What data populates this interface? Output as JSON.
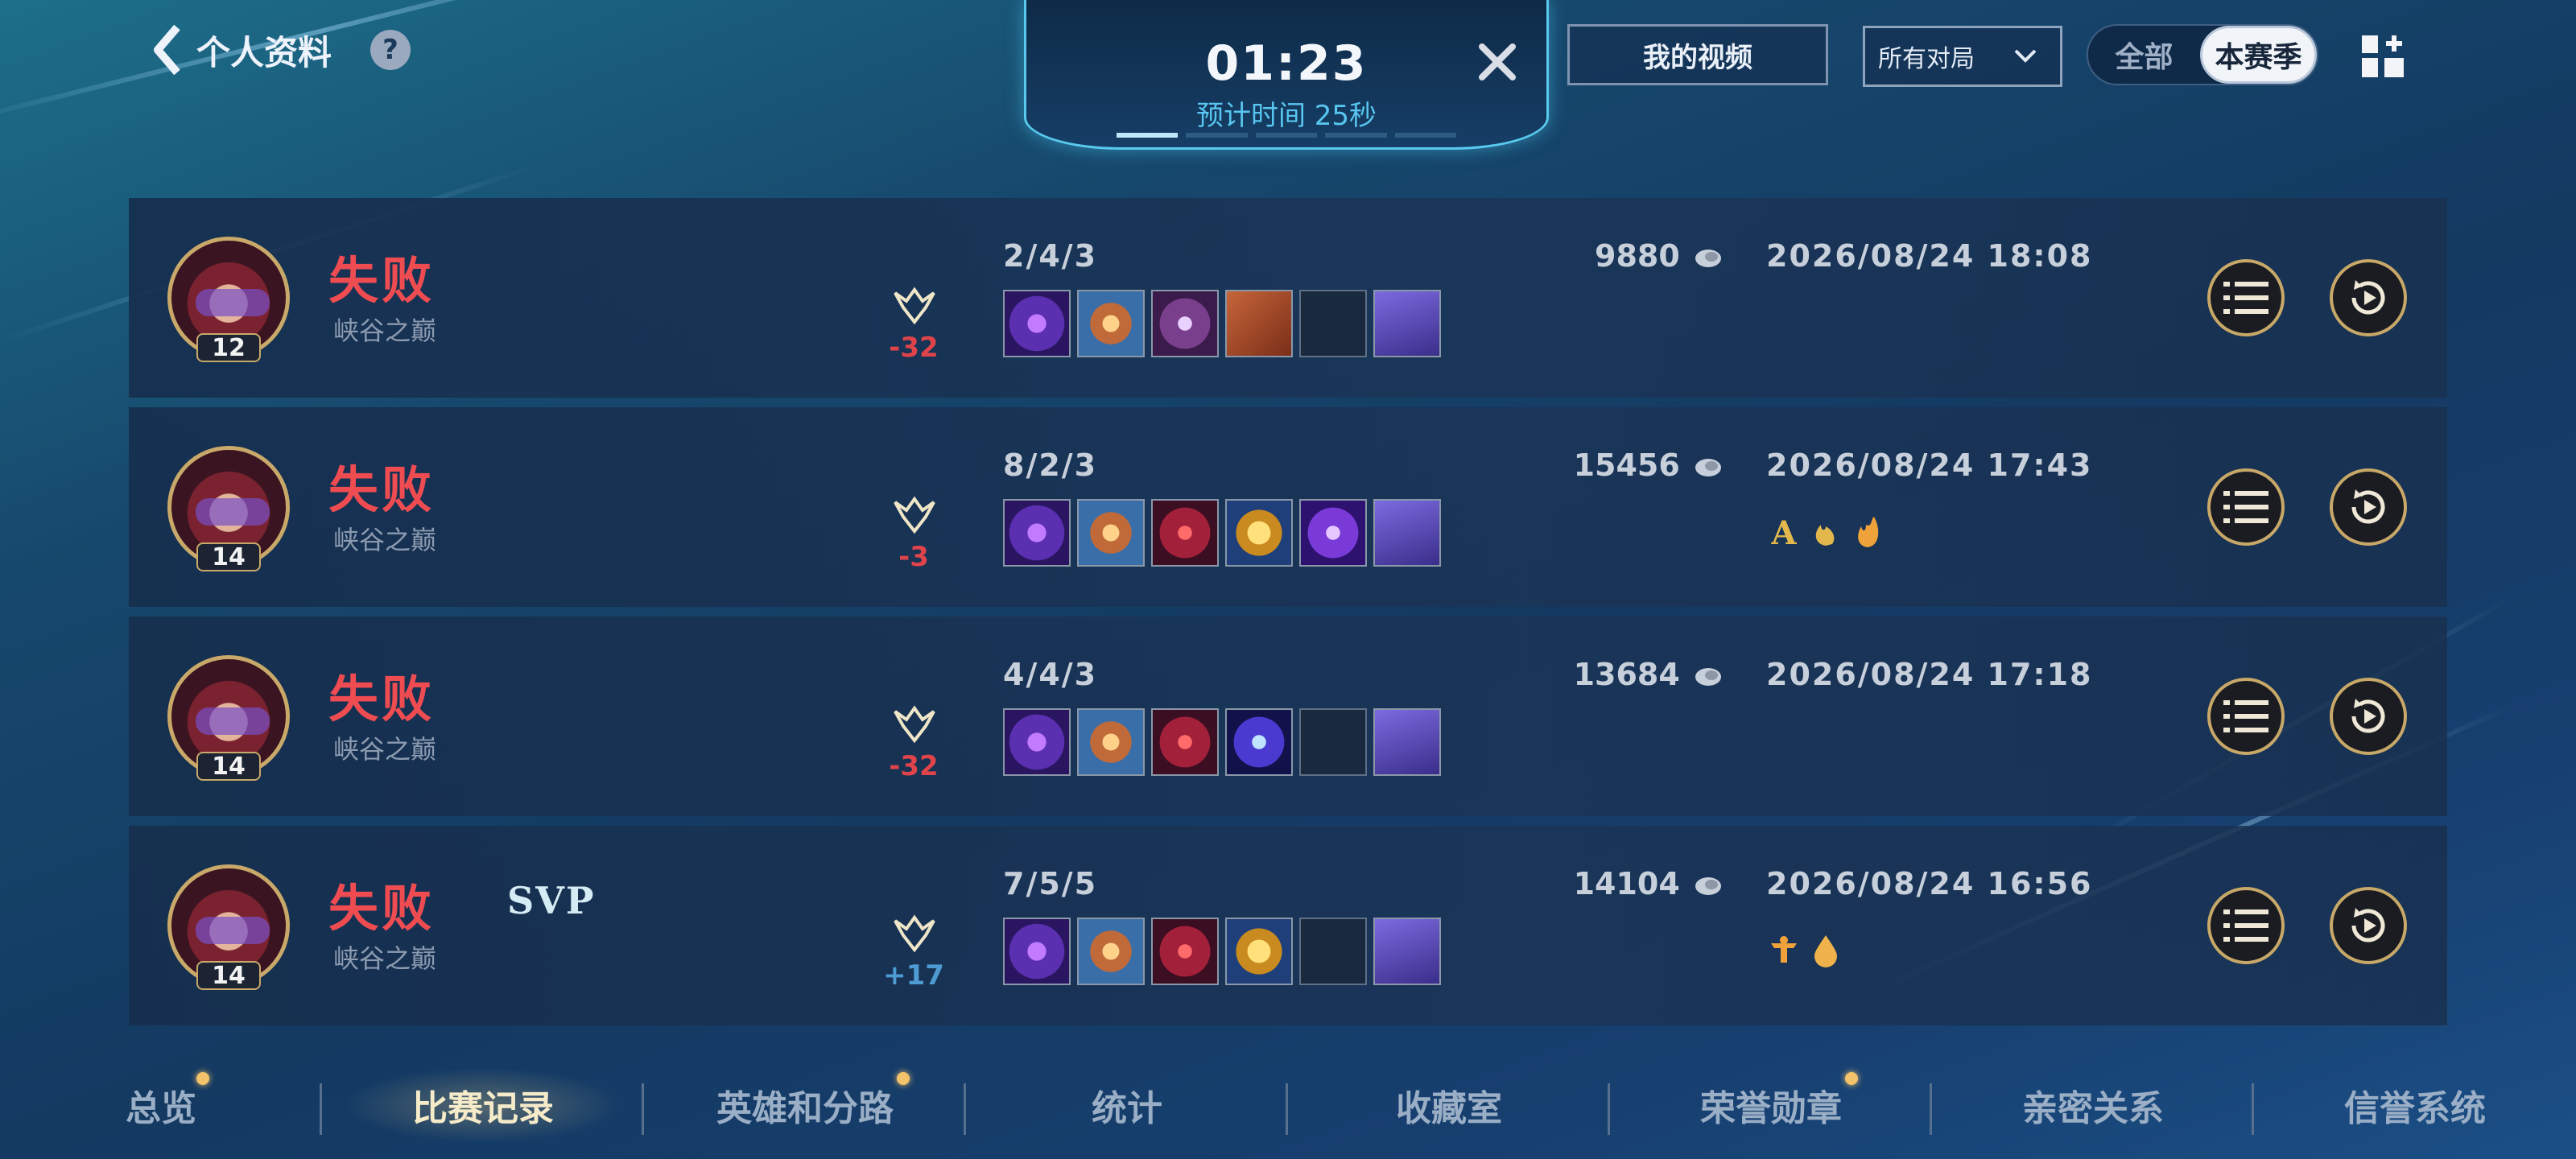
{
  "header": {
    "back_label": "个人资料",
    "help_label": "?",
    "timer": "01:23",
    "timer_sub": "预计时间 25秒",
    "my_video_label": "我的视频",
    "filter_selected": "所有对局",
    "segment": {
      "all_label": "全部",
      "season_label": "本赛季"
    }
  },
  "matches": [
    {
      "level": "12",
      "result": "失败",
      "mode": "峡谷之巅",
      "svp": "",
      "delta": "-32",
      "kda": "2/4/3",
      "gold": "9880",
      "date": "2026/08/24 18:08"
    },
    {
      "level": "14",
      "result": "失败",
      "mode": "峡谷之巅",
      "svp": "",
      "delta": "-3",
      "kda": "8/2/3",
      "gold": "15456",
      "date": "2026/08/24 17:43",
      "badge_text": "A"
    },
    {
      "level": "14",
      "result": "失败",
      "mode": "峡谷之巅",
      "svp": "",
      "delta": "-32",
      "kda": "4/4/3",
      "gold": "13684",
      "date": "2026/08/24 17:18"
    },
    {
      "level": "14",
      "result": "失败",
      "mode": "峡谷之巅",
      "svp": "SVP",
      "delta": "+17",
      "kda": "7/5/5",
      "gold": "14104",
      "date": "2026/08/24 16:56"
    }
  ],
  "nav": {
    "tabs": [
      {
        "label": "总览"
      },
      {
        "label": "比赛记录"
      },
      {
        "label": "英雄和分路"
      },
      {
        "label": "统计"
      },
      {
        "label": "收藏室"
      },
      {
        "label": "荣誉勋章"
      },
      {
        "label": "亲密关系"
      },
      {
        "label": "信誉系统"
      }
    ]
  },
  "colors": {
    "loss": "#ef4c52",
    "gain": "#4d9bd2",
    "gold_frame": "#c7a868",
    "accent": "#58c6f0"
  }
}
